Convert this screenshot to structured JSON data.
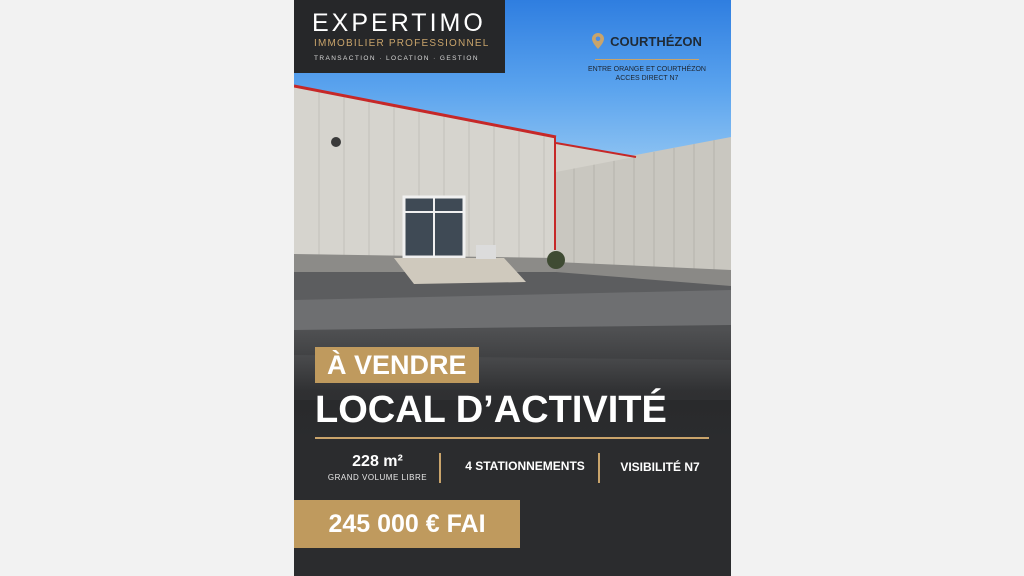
{
  "brand": {
    "name": "EXPERTIMO",
    "tagline": "IMMOBILIER PROFESSIONNEL",
    "services": "TRANSACTION  ·  LOCATION  ·  GESTION"
  },
  "location": {
    "city": "COURTHÉZON",
    "desc_line1": "ENTRE ORANGE ET COURTHÉZON",
    "desc_line2": "ACCES DIRECT N7",
    "icon": "map-pin-icon"
  },
  "listing": {
    "status": "À VENDRE",
    "title": "LOCAL D’ACTIVITÉ",
    "features": [
      {
        "main": "228 m²",
        "sub": "GRAND VOLUME LIBRE"
      },
      {
        "main": "4 STATIONNEMENTS"
      },
      {
        "main": "VISIBILITÉ N7"
      }
    ],
    "price": "245 000 € FAI"
  },
  "colors": {
    "gold": "#bf9a5e",
    "dark": "#262729",
    "sky": "#3b8be6"
  }
}
